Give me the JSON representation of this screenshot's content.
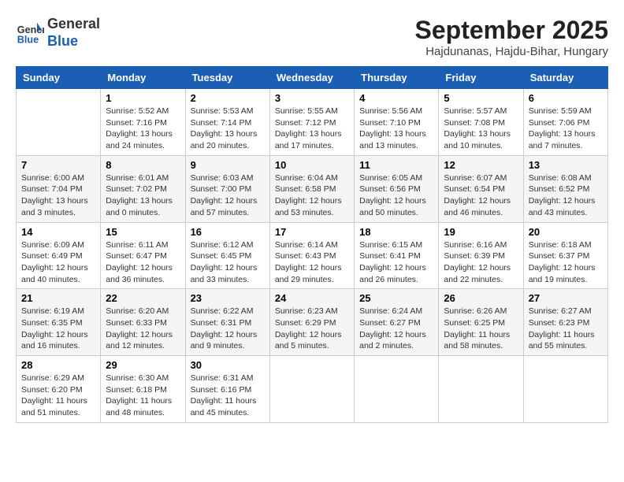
{
  "logo": {
    "general": "General",
    "blue": "Blue"
  },
  "title": "September 2025",
  "location": "Hajdunanas, Hajdu-Bihar, Hungary",
  "days_header": [
    "Sunday",
    "Monday",
    "Tuesday",
    "Wednesday",
    "Thursday",
    "Friday",
    "Saturday"
  ],
  "weeks": [
    [
      {
        "day": "",
        "info": ""
      },
      {
        "day": "1",
        "info": "Sunrise: 5:52 AM\nSunset: 7:16 PM\nDaylight: 13 hours\nand 24 minutes."
      },
      {
        "day": "2",
        "info": "Sunrise: 5:53 AM\nSunset: 7:14 PM\nDaylight: 13 hours\nand 20 minutes."
      },
      {
        "day": "3",
        "info": "Sunrise: 5:55 AM\nSunset: 7:12 PM\nDaylight: 13 hours\nand 17 minutes."
      },
      {
        "day": "4",
        "info": "Sunrise: 5:56 AM\nSunset: 7:10 PM\nDaylight: 13 hours\nand 13 minutes."
      },
      {
        "day": "5",
        "info": "Sunrise: 5:57 AM\nSunset: 7:08 PM\nDaylight: 13 hours\nand 10 minutes."
      },
      {
        "day": "6",
        "info": "Sunrise: 5:59 AM\nSunset: 7:06 PM\nDaylight: 13 hours\nand 7 minutes."
      }
    ],
    [
      {
        "day": "7",
        "info": "Sunrise: 6:00 AM\nSunset: 7:04 PM\nDaylight: 13 hours\nand 3 minutes."
      },
      {
        "day": "8",
        "info": "Sunrise: 6:01 AM\nSunset: 7:02 PM\nDaylight: 13 hours\nand 0 minutes."
      },
      {
        "day": "9",
        "info": "Sunrise: 6:03 AM\nSunset: 7:00 PM\nDaylight: 12 hours\nand 57 minutes."
      },
      {
        "day": "10",
        "info": "Sunrise: 6:04 AM\nSunset: 6:58 PM\nDaylight: 12 hours\nand 53 minutes."
      },
      {
        "day": "11",
        "info": "Sunrise: 6:05 AM\nSunset: 6:56 PM\nDaylight: 12 hours\nand 50 minutes."
      },
      {
        "day": "12",
        "info": "Sunrise: 6:07 AM\nSunset: 6:54 PM\nDaylight: 12 hours\nand 46 minutes."
      },
      {
        "day": "13",
        "info": "Sunrise: 6:08 AM\nSunset: 6:52 PM\nDaylight: 12 hours\nand 43 minutes."
      }
    ],
    [
      {
        "day": "14",
        "info": "Sunrise: 6:09 AM\nSunset: 6:49 PM\nDaylight: 12 hours\nand 40 minutes."
      },
      {
        "day": "15",
        "info": "Sunrise: 6:11 AM\nSunset: 6:47 PM\nDaylight: 12 hours\nand 36 minutes."
      },
      {
        "day": "16",
        "info": "Sunrise: 6:12 AM\nSunset: 6:45 PM\nDaylight: 12 hours\nand 33 minutes."
      },
      {
        "day": "17",
        "info": "Sunrise: 6:14 AM\nSunset: 6:43 PM\nDaylight: 12 hours\nand 29 minutes."
      },
      {
        "day": "18",
        "info": "Sunrise: 6:15 AM\nSunset: 6:41 PM\nDaylight: 12 hours\nand 26 minutes."
      },
      {
        "day": "19",
        "info": "Sunrise: 6:16 AM\nSunset: 6:39 PM\nDaylight: 12 hours\nand 22 minutes."
      },
      {
        "day": "20",
        "info": "Sunrise: 6:18 AM\nSunset: 6:37 PM\nDaylight: 12 hours\nand 19 minutes."
      }
    ],
    [
      {
        "day": "21",
        "info": "Sunrise: 6:19 AM\nSunset: 6:35 PM\nDaylight: 12 hours\nand 16 minutes."
      },
      {
        "day": "22",
        "info": "Sunrise: 6:20 AM\nSunset: 6:33 PM\nDaylight: 12 hours\nand 12 minutes."
      },
      {
        "day": "23",
        "info": "Sunrise: 6:22 AM\nSunset: 6:31 PM\nDaylight: 12 hours\nand 9 minutes."
      },
      {
        "day": "24",
        "info": "Sunrise: 6:23 AM\nSunset: 6:29 PM\nDaylight: 12 hours\nand 5 minutes."
      },
      {
        "day": "25",
        "info": "Sunrise: 6:24 AM\nSunset: 6:27 PM\nDaylight: 12 hours\nand 2 minutes."
      },
      {
        "day": "26",
        "info": "Sunrise: 6:26 AM\nSunset: 6:25 PM\nDaylight: 11 hours\nand 58 minutes."
      },
      {
        "day": "27",
        "info": "Sunrise: 6:27 AM\nSunset: 6:23 PM\nDaylight: 11 hours\nand 55 minutes."
      }
    ],
    [
      {
        "day": "28",
        "info": "Sunrise: 6:29 AM\nSunset: 6:20 PM\nDaylight: 11 hours\nand 51 minutes."
      },
      {
        "day": "29",
        "info": "Sunrise: 6:30 AM\nSunset: 6:18 PM\nDaylight: 11 hours\nand 48 minutes."
      },
      {
        "day": "30",
        "info": "Sunrise: 6:31 AM\nSunset: 6:16 PM\nDaylight: 11 hours\nand 45 minutes."
      },
      {
        "day": "",
        "info": ""
      },
      {
        "day": "",
        "info": ""
      },
      {
        "day": "",
        "info": ""
      },
      {
        "day": "",
        "info": ""
      }
    ]
  ]
}
